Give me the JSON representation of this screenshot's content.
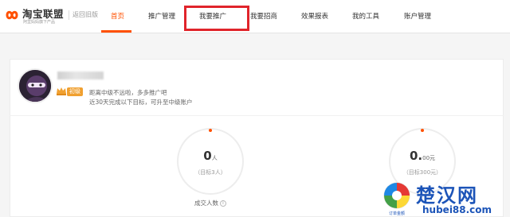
{
  "brand": {
    "name": "淘宝联盟",
    "tagline": "阿里妈妈旗下产品",
    "back_old": "返回旧版",
    "accent": "#ff5000"
  },
  "nav": {
    "items": [
      {
        "label": "首页",
        "active": true
      },
      {
        "label": "推广管理"
      },
      {
        "label": "我要推广",
        "highlighted": true
      },
      {
        "label": "我要招商"
      },
      {
        "label": "效果报表"
      },
      {
        "label": "我的工具"
      },
      {
        "label": "账户管理"
      }
    ],
    "highlight_color": "#e0242b"
  },
  "profile": {
    "username_blurred": true,
    "level": "初级",
    "tip_line1": "距离中级不远啦，多多推广吧",
    "tip_line2": "近30天完成以下目标，可升至中级账户"
  },
  "stats": [
    {
      "value": "0",
      "unit": "人",
      "target": "（目标3人）",
      "label": "成交人数"
    },
    {
      "value": "0.",
      "unit": "00元",
      "target": "（目标300元）",
      "label": ""
    }
  ],
  "watermark": {
    "title": "楚汉网",
    "url": "hubei88.com",
    "small_text": "订单金额"
  }
}
